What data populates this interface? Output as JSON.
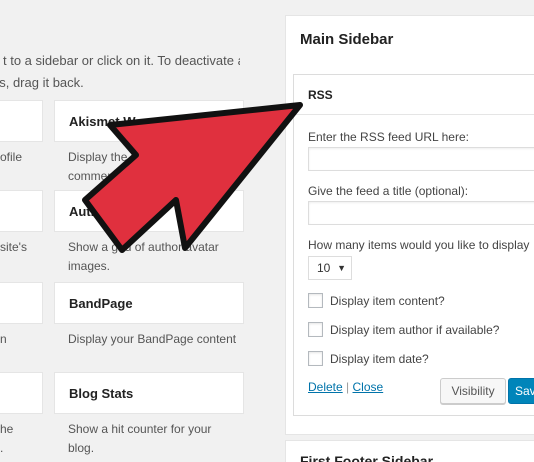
{
  "intro": {
    "line1": "t to a sidebar or click on it. To deactivate a",
    "line2": "gs, drag it back."
  },
  "widgets": {
    "left_col": {
      "desc1": "ofile",
      "desc2": "site's",
      "desc3": "n",
      "desc4a": "he",
      "desc4b": "."
    },
    "akismet": {
      "name": "Akismet W",
      "desc_line1": "Display the numb",
      "desc_line2": "comments b"
    },
    "author": {
      "name": "Autho",
      "desc_line1": "Show a grid of author avatar",
      "desc_line2": "images."
    },
    "bandpage": {
      "name": "BandPage",
      "desc": "Display your BandPage content"
    },
    "blogstats": {
      "name": "Blog Stats",
      "desc_line1": "Show a hit counter for your",
      "desc_line2": "blog."
    }
  },
  "main_sidebar": {
    "title": "Main Sidebar",
    "rss": {
      "title": "RSS",
      "url_label": "Enter the RSS feed URL here:",
      "url_value": "",
      "title_label": "Give the feed a title (optional):",
      "title_value": "",
      "items_label": "How many items would you like to display",
      "items_value": "10",
      "caret_icon": "caret-down-icon",
      "opt_content": "Display item content?",
      "opt_author": "Display item author if available?",
      "opt_date": "Display item date?",
      "delete_label": "Delete",
      "separator": "|",
      "close_label": "Close",
      "visibility_label": "Visibility",
      "save_label": "Sav"
    }
  },
  "footer_sidebar": {
    "title": "First Footer Sidebar"
  },
  "colors": {
    "arrow_fill": "#e0303e",
    "arrow_stroke": "#111111",
    "primary_button": "#0085ba",
    "link": "#0073aa"
  }
}
